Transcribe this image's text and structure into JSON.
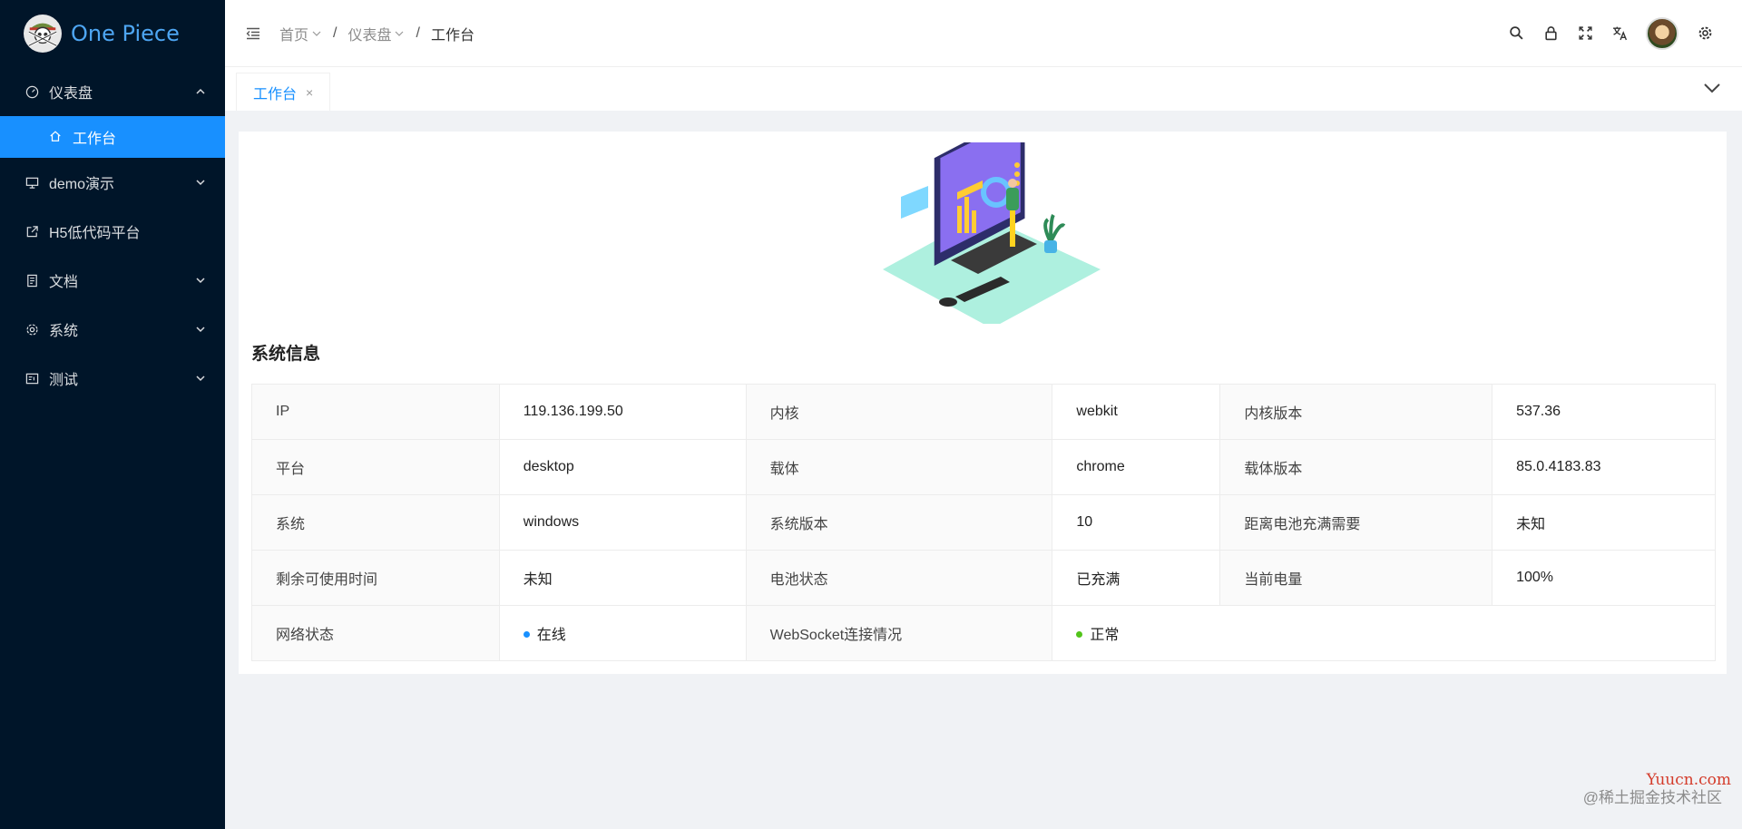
{
  "app": {
    "logo_text": "One Piece"
  },
  "sidebar": {
    "items": [
      {
        "label": "仪表盘",
        "icon": "dashboard-icon",
        "expanded": true,
        "children": [
          {
            "label": "工作台",
            "icon": "home-icon",
            "active": true
          }
        ]
      },
      {
        "label": "demo演示",
        "icon": "desktop-icon"
      },
      {
        "label": "H5低代码平台",
        "icon": "external-link-icon"
      },
      {
        "label": "文档",
        "icon": "document-icon"
      },
      {
        "label": "系统",
        "icon": "settings-icon"
      },
      {
        "label": "测试",
        "icon": "table-icon"
      }
    ]
  },
  "header": {
    "breadcrumb": [
      "首页",
      "仪表盘",
      "工作台"
    ],
    "icons": [
      "search-icon",
      "lock-icon",
      "fullscreen-icon",
      "translate-icon",
      "avatar",
      "gear-icon"
    ]
  },
  "tabs": [
    {
      "label": "工作台",
      "close": "×",
      "active": true
    }
  ],
  "system_info": {
    "title": "系统信息",
    "rows": [
      [
        {
          "label": "IP",
          "value": "119.136.199.50"
        },
        {
          "label": "内核",
          "value": "webkit"
        },
        {
          "label": "内核版本",
          "value": "537.36"
        }
      ],
      [
        {
          "label": "平台",
          "value": "desktop"
        },
        {
          "label": "载体",
          "value": "chrome"
        },
        {
          "label": "载体版本",
          "value": "85.0.4183.83"
        }
      ],
      [
        {
          "label": "系统",
          "value": "windows"
        },
        {
          "label": "系统版本",
          "value": "10"
        },
        {
          "label": "距离电池充满需要",
          "value": "未知"
        }
      ],
      [
        {
          "label": "剩余可使用时间",
          "value": "未知"
        },
        {
          "label": "电池状态",
          "value": "已充满"
        },
        {
          "label": "当前电量",
          "value": "100%"
        }
      ]
    ],
    "last_row": {
      "network_label": "网络状态",
      "network_value": "在线",
      "ws_label": "WebSocket连接情况",
      "ws_value": "正常"
    }
  },
  "colors": {
    "sidebar_bg": "#001529",
    "accent": "#1890ff",
    "online_dot": "#1890ff",
    "ok_dot": "#52c41a"
  },
  "watermark": {
    "line1": "Yuucn.com",
    "line2": "@稀土掘金技术社区"
  }
}
